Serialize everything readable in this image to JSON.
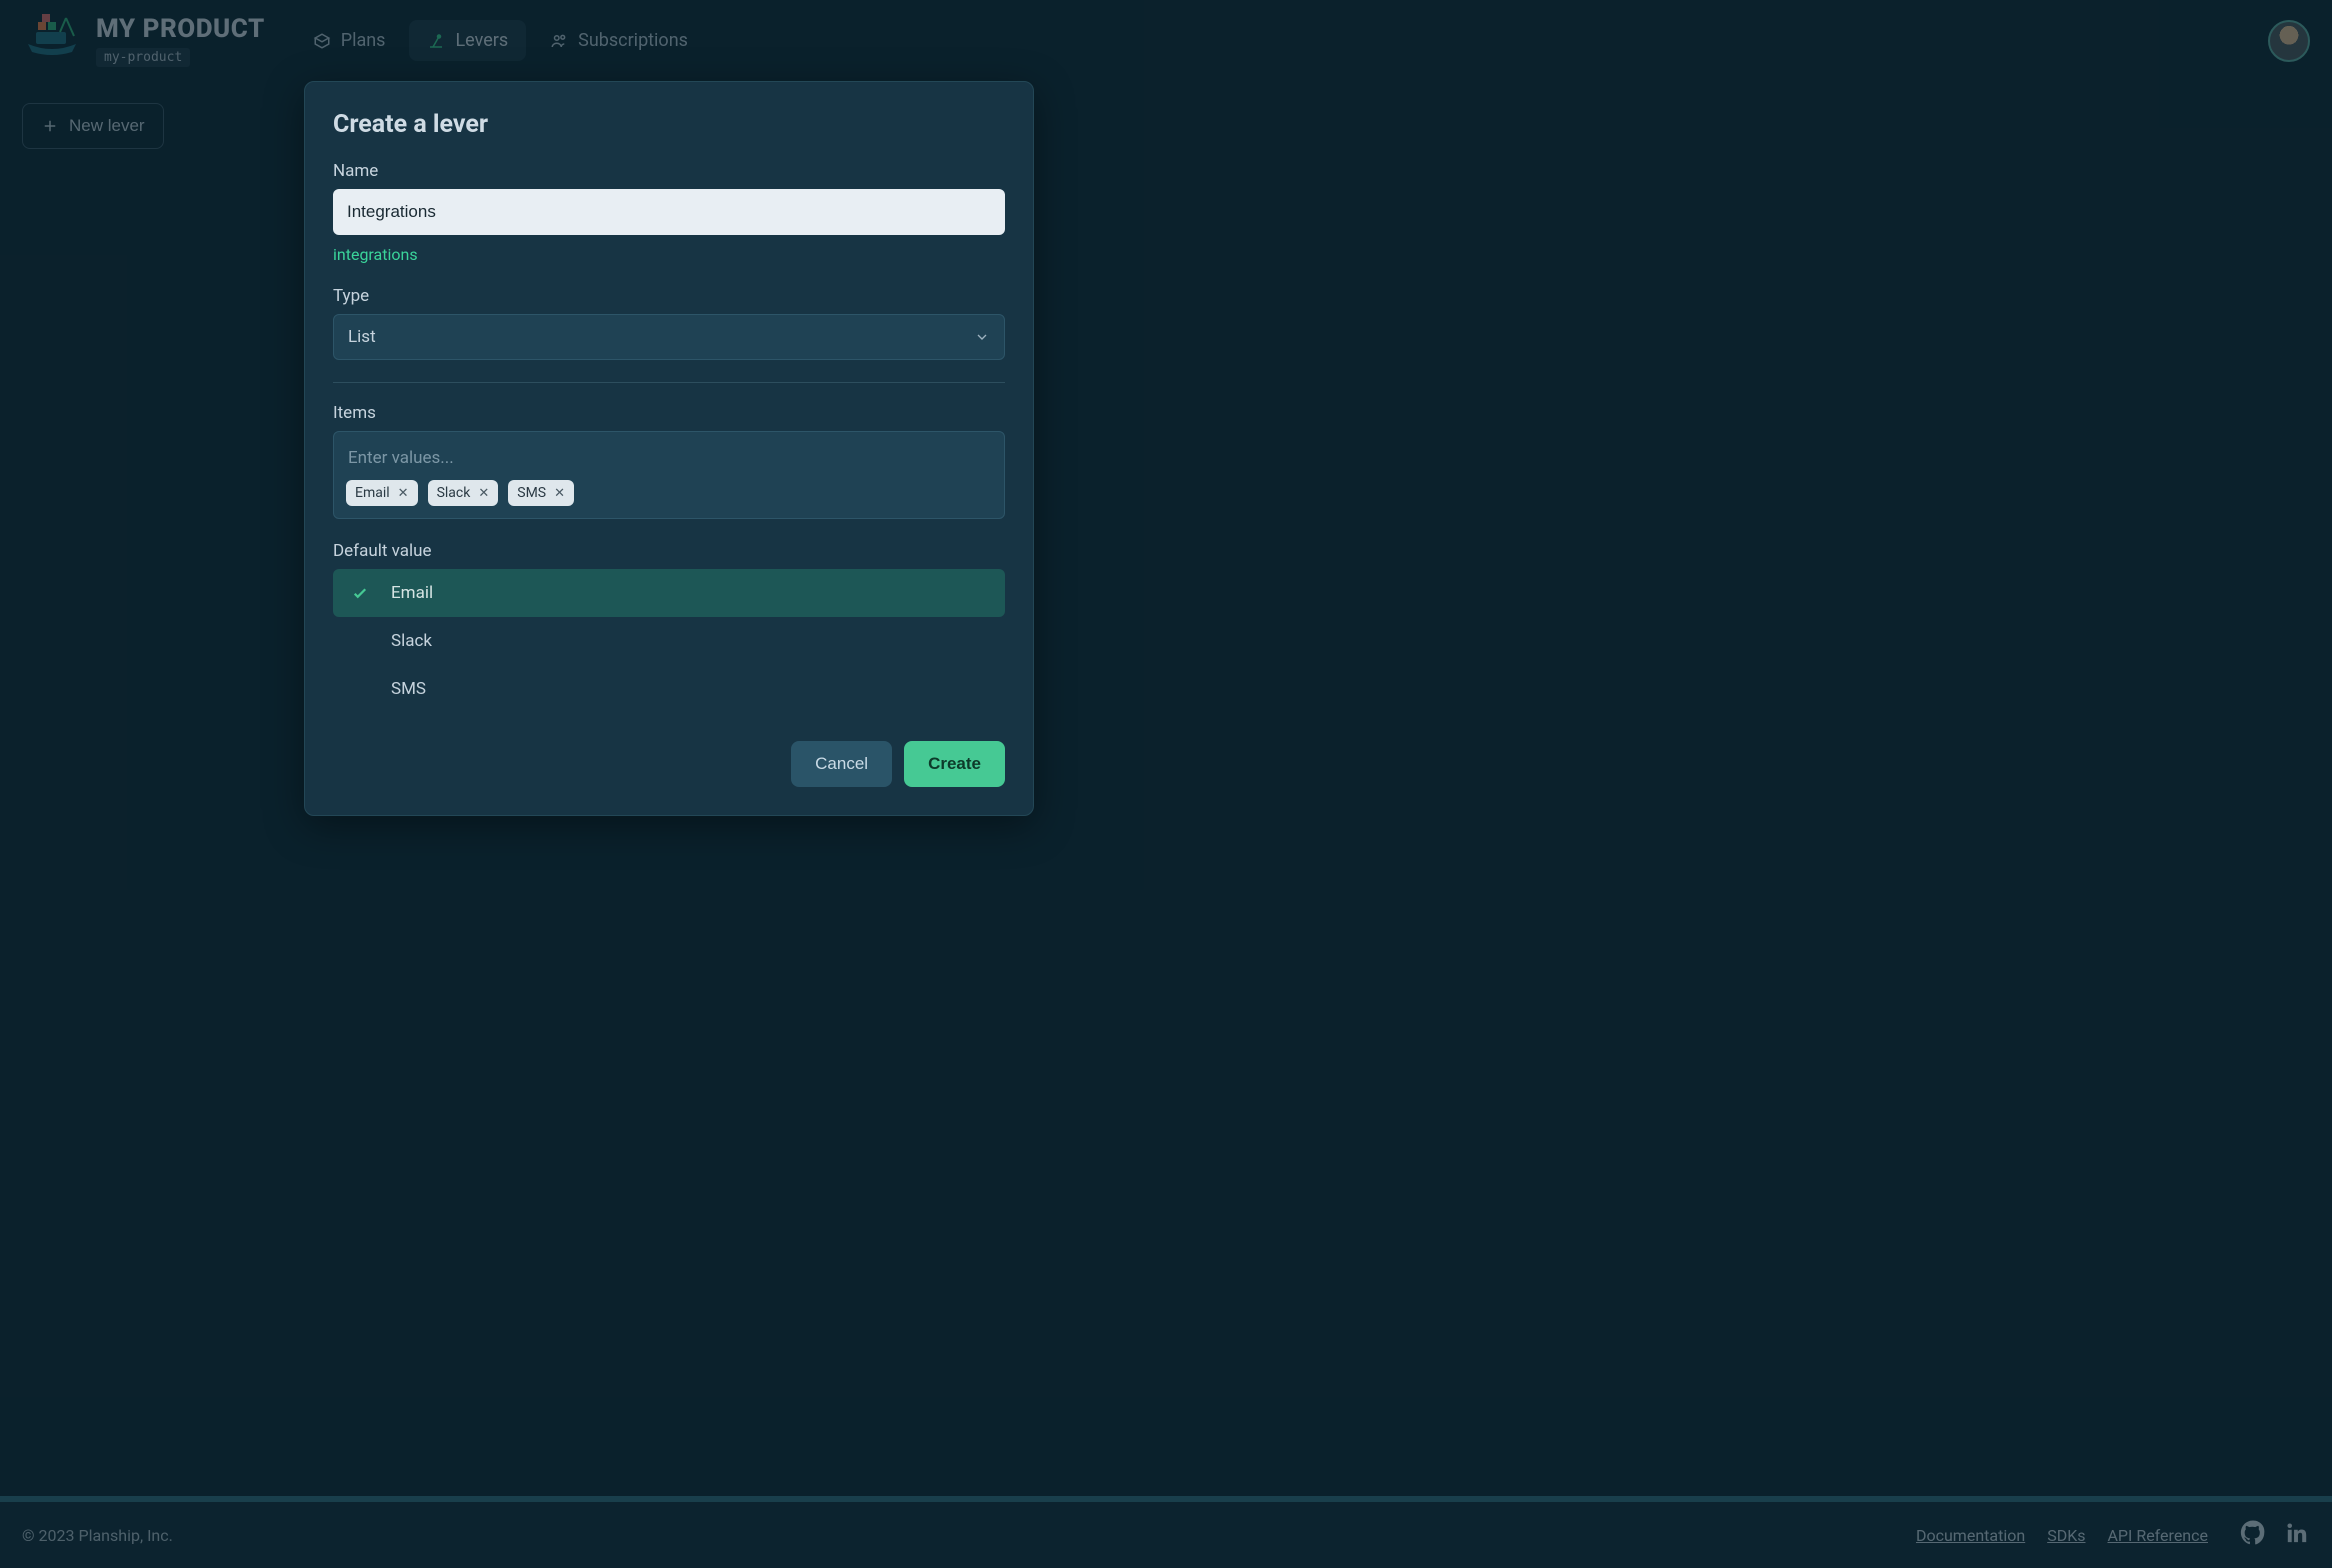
{
  "header": {
    "product_title": "MY PRODUCT",
    "product_slug": "my-product",
    "nav": [
      {
        "key": "plans",
        "label": "Plans"
      },
      {
        "key": "levers",
        "label": "Levers"
      },
      {
        "key": "subscriptions",
        "label": "Subscriptions"
      }
    ]
  },
  "page": {
    "new_lever_label": "New lever"
  },
  "modal": {
    "title": "Create a lever",
    "name_label": "Name",
    "name_value": "Integrations",
    "slug_hint": "integrations",
    "type_label": "Type",
    "type_value": "List",
    "items_label": "Items",
    "items_placeholder": "Enter values...",
    "items": [
      "Email",
      "Slack",
      "SMS"
    ],
    "default_label": "Default value",
    "default_options": [
      "Email",
      "Slack",
      "SMS"
    ],
    "default_selected": "Email",
    "cancel_label": "Cancel",
    "create_label": "Create"
  },
  "footer": {
    "copyright": "© 2023 Planship, Inc.",
    "links": [
      {
        "key": "docs",
        "label": "Documentation"
      },
      {
        "key": "sdks",
        "label": "SDKs"
      },
      {
        "key": "api",
        "label": "API Reference"
      }
    ]
  }
}
